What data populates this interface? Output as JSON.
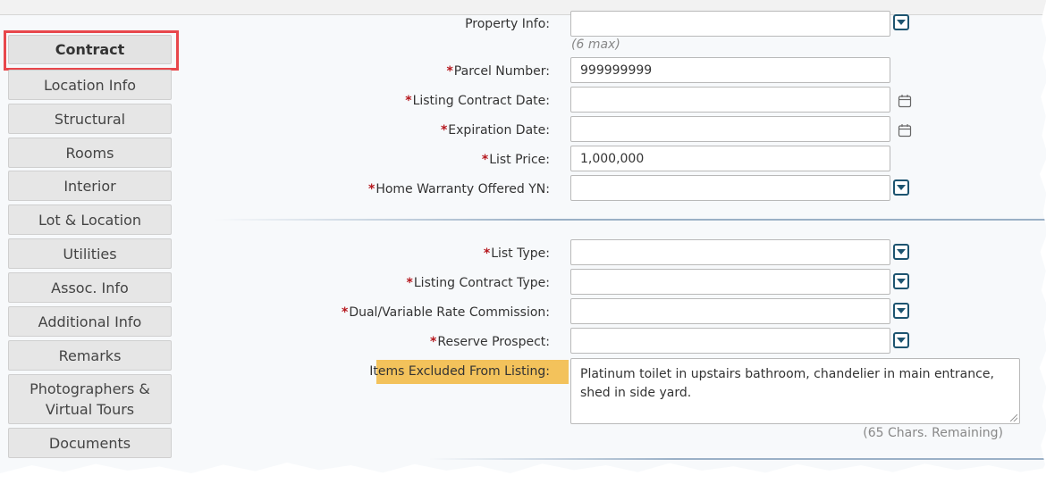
{
  "sidebar": {
    "items": [
      {
        "label": "Contract"
      },
      {
        "label": "Location Info"
      },
      {
        "label": "Structural"
      },
      {
        "label": "Rooms"
      },
      {
        "label": "Interior"
      },
      {
        "label": "Lot & Location"
      },
      {
        "label": "Utilities"
      },
      {
        "label": "Assoc. Info"
      },
      {
        "label": "Additional Info"
      },
      {
        "label": "Remarks"
      },
      {
        "label": "Photographers & Virtual Tours"
      },
      {
        "label": "Documents"
      }
    ]
  },
  "form": {
    "required_mark": "*",
    "property_info": {
      "label": "Property Info:",
      "value": "",
      "hint": "(6 max)"
    },
    "parcel_number": {
      "label": "Parcel Number:",
      "value": "999999999"
    },
    "listing_contract_date": {
      "label": "Listing Contract Date:",
      "value": ""
    },
    "expiration_date": {
      "label": "Expiration Date:",
      "value": ""
    },
    "list_price": {
      "label": "List Price:",
      "value": "1,000,000"
    },
    "home_warranty": {
      "label": "Home Warranty Offered YN:",
      "value": ""
    },
    "list_type": {
      "label": "List Type:",
      "value": ""
    },
    "listing_contract_type": {
      "label": "Listing Contract Type:",
      "value": ""
    },
    "dual_rate": {
      "label": "Dual/Variable Rate Commission:",
      "value": ""
    },
    "reserve_prospect": {
      "label": "Reserve Prospect:",
      "value": ""
    },
    "items_excluded": {
      "label": "Items Excluded From Listing:",
      "value": "Platinum toilet in upstairs bathroom, chandelier in main entrance, shed in side yard.",
      "chars_remaining": "(65 Chars. Remaining)"
    }
  },
  "icons": {
    "dropdown": "dropdown-arrow-icon",
    "calendar": "calendar-icon"
  },
  "colors": {
    "required": "#b5161c",
    "highlight": "#f3c25b",
    "active_outline": "#e8474c",
    "dropdown_accent": "#1d5470"
  }
}
